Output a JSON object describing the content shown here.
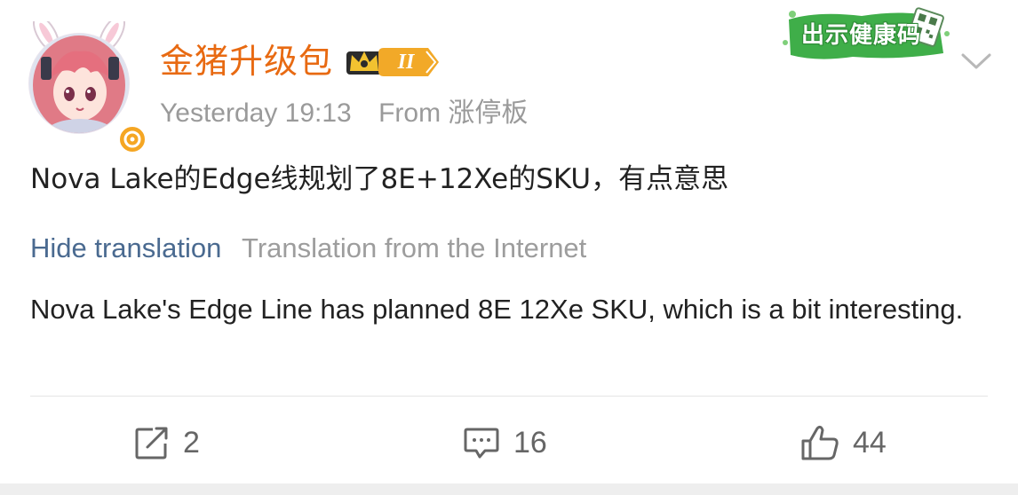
{
  "post": {
    "username": "金猪升级包",
    "rank_level": "II",
    "time": "Yesterday 19:13",
    "source_prefix": "From",
    "source": "涨停板",
    "health_code_label": "出示健康码",
    "content": "Nova Lake的Edge线规划了8E+12Xe的SKU，有点意思",
    "hide_translation_label": "Hide translation",
    "translation_source": "Translation from the Internet",
    "translated_text": "Nova Lake's Edge Line has planned 8E 12Xe SKU, which is a bit interesting."
  },
  "actions": {
    "repost_count": "2",
    "comment_count": "16",
    "like_count": "44"
  },
  "colors": {
    "username": "#e86a12",
    "link": "#4a6a90",
    "muted": "#9a9a9a",
    "verified_badge": "#f5a623",
    "health_code_green": "#3fae49"
  },
  "icons": {
    "rank": "crown-icon",
    "verified": "verified-icon",
    "more": "chevron-down-icon",
    "repost": "repost-icon",
    "comment": "comment-icon",
    "like": "like-icon"
  }
}
